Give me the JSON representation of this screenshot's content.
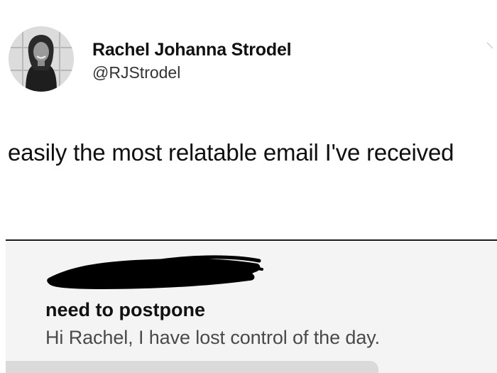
{
  "author": {
    "display_name": "Rachel Johanna Strodel",
    "handle": "@RJStrodel",
    "avatar_icon": "profile-photo"
  },
  "tweet": {
    "text": "easily the most relatable email I've received"
  },
  "email": {
    "sender_redacted": true,
    "subject": "need to postpone",
    "preview": "Hi Rachel, I have lost control of the day."
  },
  "colors": {
    "background": "#ffffff",
    "email_card_bg": "#f4f4f4",
    "redaction": "#000000",
    "preview_text": "#4a4a4a"
  }
}
